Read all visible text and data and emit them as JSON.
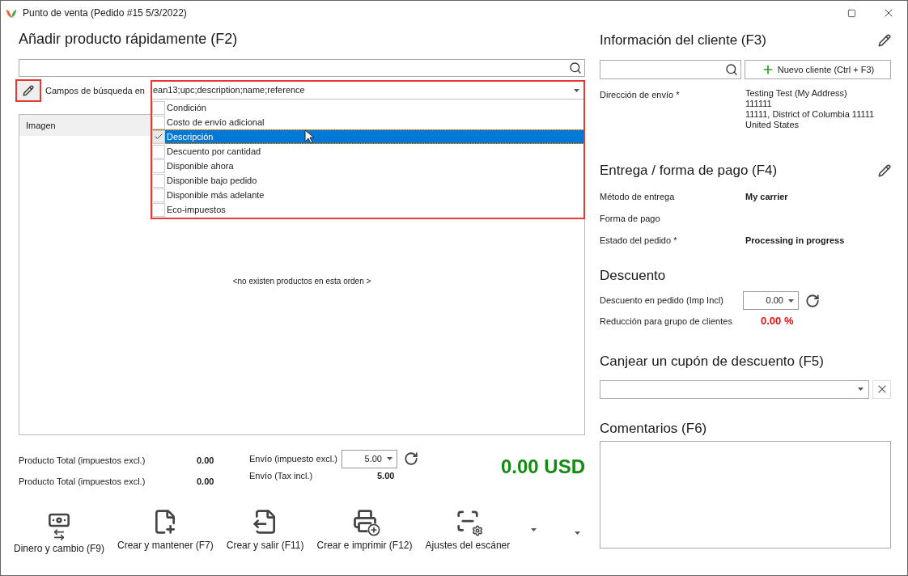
{
  "window": {
    "title": "Punto de venta (Pedido #15 5/3/2022)"
  },
  "quick_add": {
    "title": "Añadir producto rápidamente (F2)",
    "search_fields_label": "Campos de búsqueda en",
    "search_fields_value": "ean13;upc;description;name;reference",
    "options": [
      {
        "label": "Condición",
        "checked": false,
        "selected": false
      },
      {
        "label": "Costo de envío adicional",
        "checked": false,
        "selected": false
      },
      {
        "label": "Descripción",
        "checked": true,
        "selected": true
      },
      {
        "label": "Descuento por cantidad",
        "checked": false,
        "selected": false
      },
      {
        "label": "Disponible ahora",
        "checked": false,
        "selected": false
      },
      {
        "label": "Disponible bajo pedido",
        "checked": false,
        "selected": false
      },
      {
        "label": "Disponible más adelante",
        "checked": false,
        "selected": false
      },
      {
        "label": "Eco-impuestos",
        "checked": false,
        "selected": false
      }
    ],
    "table": {
      "columns": [
        "Imagen"
      ],
      "empty_message": "<no existen productos en esta orden >"
    }
  },
  "totals": {
    "products": [
      {
        "label": "Producto Total (impuestos excl.)",
        "value": "0.00"
      },
      {
        "label": "Producto Total (impuestos excl.)",
        "value": "0.00"
      }
    ],
    "shipping_excl": {
      "label": "Envío (impuesto excl.)",
      "value": "5.00"
    },
    "shipping_incl": {
      "label": "Envío (Tax incl.)",
      "value": "5.00"
    },
    "grand_total": "0.00 USD"
  },
  "actions": [
    {
      "kind": "money",
      "label": "Dinero y cambio (F9)"
    },
    {
      "kind": "create-keep",
      "label": "Crear y mantener (F7)"
    },
    {
      "kind": "create-exit",
      "label": "Crear y salir (F11)"
    },
    {
      "kind": "create-print",
      "label": "Crear e imprimir (F12)"
    },
    {
      "kind": "scanner",
      "label": "Ajustes del escáner"
    }
  ],
  "customer": {
    "title": "Información del cliente (F3)",
    "new_button": "Nuevo cliente (Ctrl + F3)",
    "address_label": "Dirección de envío *",
    "address_lines": [
      "Testing Test (My Address)",
      "111111",
      "11111, District of Columbia 11111",
      "United States"
    ]
  },
  "delivery": {
    "title": "Entrega / forma de pago (F4)",
    "fields": [
      {
        "label": "Método de entrega",
        "value": "My carrier"
      },
      {
        "label": "Forma de pago"
      },
      {
        "label": "Estado del pedido *",
        "value": "Processing in progress"
      }
    ]
  },
  "discount": {
    "title": "Descuento",
    "order_discount": {
      "label": "Descuento en pedido (Imp Incl)",
      "value": "0.00"
    },
    "group_reduction": {
      "label": "Reducción para grupo de clientes",
      "value": "0.00 %"
    }
  },
  "coupon": {
    "title": "Canjear un cupón de descuento (F5)"
  },
  "comments": {
    "title": "Comentarios (F6)"
  }
}
